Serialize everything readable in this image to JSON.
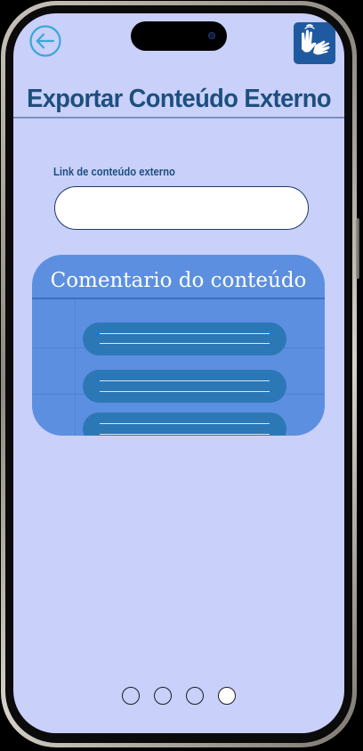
{
  "header": {
    "back_icon": "arrow-left-circle-icon",
    "sign_language_icon": "sign-language-hands-icon",
    "title": "Exportar Conteúdo Externo"
  },
  "link_field": {
    "label": "Link de conteúdo externo",
    "value": "",
    "placeholder": ""
  },
  "comment_card": {
    "title": "Comentario do conteúdo",
    "lines": [
      {
        "name": "comment-line-1"
      },
      {
        "name": "comment-line-2"
      },
      {
        "name": "comment-line-3"
      }
    ]
  },
  "pager": {
    "count": 4,
    "active_index": 3
  },
  "colors": {
    "screen_background": "#c9d0fa",
    "title_text": "#1d4f7e",
    "card_background": "#5c8fe0",
    "comment_line": "#2c78b6",
    "sign_language_button": "#1f5aa0",
    "back_icon_stroke": "#3aa6d8"
  }
}
